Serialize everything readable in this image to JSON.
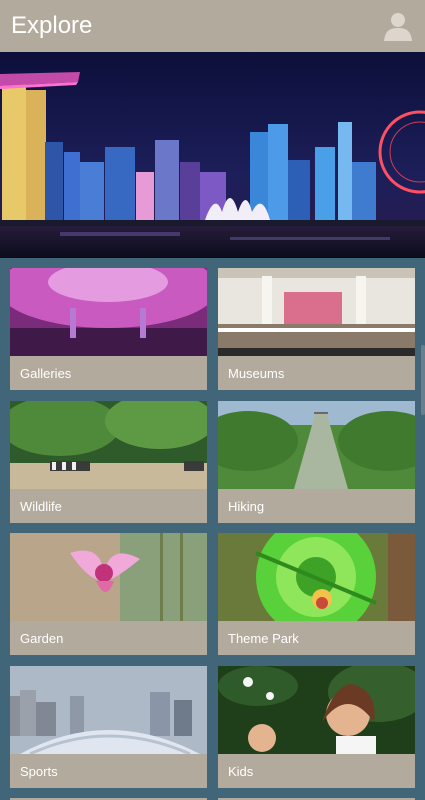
{
  "header": {
    "title": "Explore",
    "profile_icon": "person-icon"
  },
  "hero": {
    "alt_icon": "city-skyline-night"
  },
  "categories": [
    {
      "label": "Galleries"
    },
    {
      "label": "Museums"
    },
    {
      "label": "Wildlife"
    },
    {
      "label": "Hiking"
    },
    {
      "label": "Garden"
    },
    {
      "label": "Theme Park"
    },
    {
      "label": "Sports"
    },
    {
      "label": "Kids"
    }
  ],
  "colors": {
    "appbar": "#b3aa9e",
    "background": "#416679",
    "tile": "#b3aa9e"
  }
}
